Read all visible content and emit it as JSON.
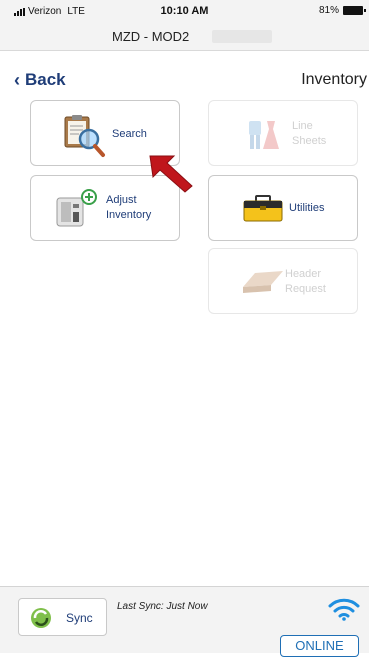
{
  "status_bar": {
    "carrier": "Verizon",
    "network": "LTE",
    "time": "10:10 AM",
    "battery": "81%"
  },
  "titlebar": {
    "device": "MZD - MOD2"
  },
  "nav": {
    "back_label": "Back",
    "title": "Inventory"
  },
  "tiles": [
    {
      "id": "search",
      "lines": [
        "Search"
      ],
      "enabled": true,
      "icon": "clipboard-magnifier-icon"
    },
    {
      "id": "line-sheets",
      "lines": [
        "Line",
        "Sheets"
      ],
      "enabled": false,
      "icon": "clothing-icon"
    },
    {
      "id": "adjust-inventory",
      "lines": [
        "Adjust",
        "Inventory"
      ],
      "enabled": true,
      "icon": "label-printer-plus-icon"
    },
    {
      "id": "utilities",
      "lines": [
        "Utilities"
      ],
      "enabled": true,
      "icon": "toolbox-icon"
    },
    {
      "id": "header-request",
      "lines": [
        "Header",
        "Request"
      ],
      "enabled": false,
      "icon": "paper-stack-icon"
    }
  ],
  "pointer": {
    "icon": "red-arrow-icon",
    "color": "#c0161c"
  },
  "footer": {
    "sync_label": "Sync",
    "last_sync": "Last Sync: Just Now",
    "status": "ONLINE",
    "status_icon": "wifi-icon"
  },
  "colors": {
    "label": "#1f3d78",
    "accent_blue": "#1f6fb5",
    "arrow_red": "#c0161c",
    "disabled": "#d0d0d0"
  }
}
